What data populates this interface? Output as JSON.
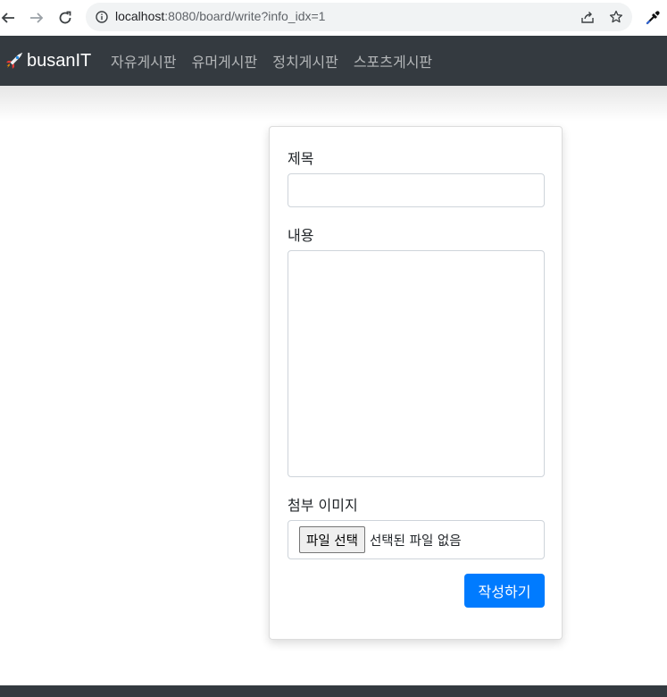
{
  "browser": {
    "url_host": "localhost",
    "url_path": ":8080/board/write?info_idx=1",
    "icons": {
      "back": "back-arrow-icon",
      "forward": "forward-arrow-icon",
      "reload": "reload-icon",
      "info": "info-icon",
      "share": "share-icon",
      "bookmark": "star-icon",
      "extension": "eyedropper-icon"
    }
  },
  "navbar": {
    "brand": "busanIT",
    "brand_icon": "rocket-icon",
    "links": [
      "자유게시판",
      "유머게시판",
      "정치게시판",
      "스포츠게시판"
    ]
  },
  "form": {
    "title_label": "제목",
    "title_value": "",
    "content_label": "내용",
    "content_value": "",
    "image_label": "첨부 이미지",
    "file_button": "파일 선택",
    "file_status": "선택된 파일 없음",
    "submit": "작성하기"
  },
  "colors": {
    "navbar_bg": "#343a40",
    "primary": "#007bff"
  }
}
